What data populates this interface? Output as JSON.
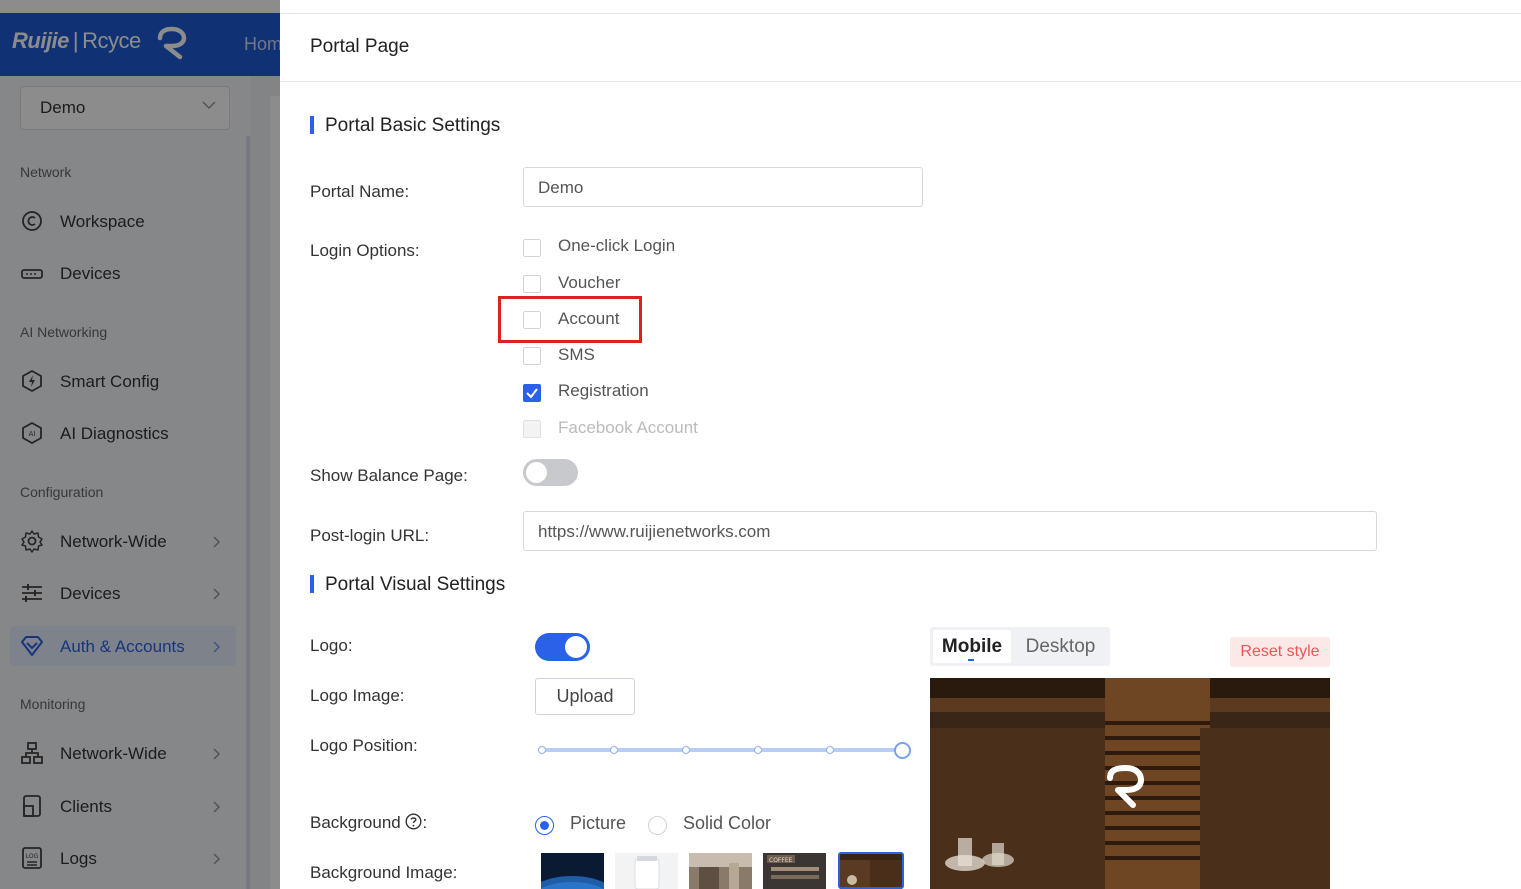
{
  "app": {
    "brand_name": "Ruijie",
    "brand_separator": "|",
    "brand_sub": "Rcyce",
    "home_tab": "Hom"
  },
  "sidebar": {
    "site_select": "Demo",
    "sections": {
      "network": "Network",
      "ai_networking": "AI Networking",
      "configuration": "Configuration",
      "monitoring": "Monitoring"
    },
    "items": {
      "workspace": "Workspace",
      "devices": "Devices",
      "smart_config": "Smart Config",
      "ai_diagnostics": "AI Diagnostics",
      "network_wide": "Network-Wide",
      "config_devices": "Devices",
      "auth_accounts": "Auth & Accounts",
      "mon_network_wide": "Network-Wide",
      "clients": "Clients",
      "logs": "Logs"
    },
    "active_item": "Auth & Accounts"
  },
  "drawer": {
    "title": "Portal Page",
    "basic_section_title": "Portal Basic Settings",
    "portal_name_label": "Portal Name:",
    "portal_name_value": "Demo",
    "login_options_label": "Login Options:",
    "login_options": [
      {
        "label": "One-click Login",
        "checked": false,
        "disabled": false
      },
      {
        "label": "Voucher",
        "checked": false,
        "disabled": false
      },
      {
        "label": "Account",
        "checked": false,
        "disabled": false
      },
      {
        "label": "SMS",
        "checked": false,
        "disabled": false
      },
      {
        "label": "Registration",
        "checked": true,
        "disabled": false
      },
      {
        "label": "Facebook Account",
        "checked": false,
        "disabled": true
      }
    ],
    "show_balance_label": "Show Balance Page:",
    "show_balance_on": false,
    "post_login_url_label": "Post-login URL:",
    "post_login_url_value": "https://www.ruijienetworks.com",
    "visual_section_title": "Portal Visual Settings",
    "logo_label": "Logo:",
    "logo_on": true,
    "logo_image_label": "Logo Image:",
    "upload_button": "Upload",
    "logo_position_label": "Logo Position:",
    "logo_position_step": 5,
    "logo_position_steps": 5,
    "background_label": "Background",
    "background_colon": ":",
    "background_help_icon": "question-circle-icon",
    "background_options": [
      {
        "label": "Picture",
        "selected": true
      },
      {
        "label": "Solid Color",
        "selected": false
      }
    ],
    "background_image_label": "Background Image:",
    "background_image_selected_index": 4,
    "preview_tabs": {
      "mobile": "Mobile",
      "desktop": "Desktop",
      "active": "Mobile"
    },
    "reset_style_button": "Reset style"
  },
  "colors": {
    "primary": "#2a61e8",
    "topbar": "#1f5ad6",
    "highlight": "#e02020",
    "reset_text": "#e55555",
    "reset_bg": "#fde8e8"
  }
}
